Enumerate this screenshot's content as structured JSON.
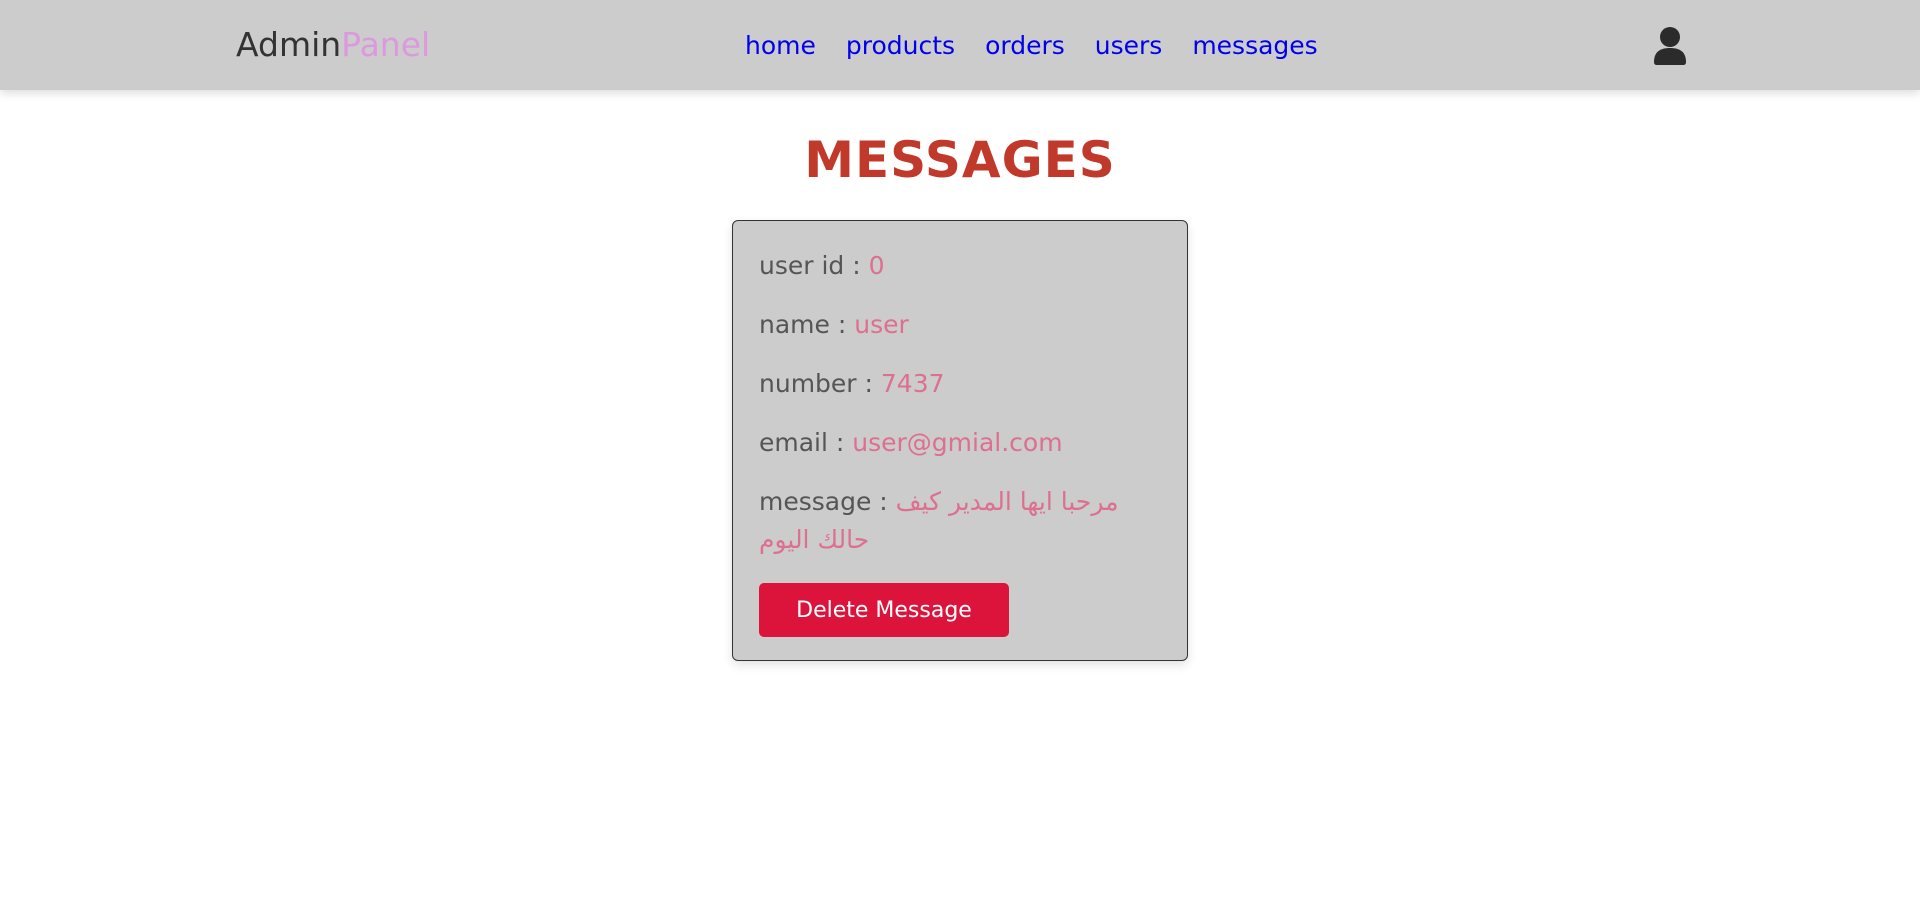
{
  "header": {
    "logo_main": "Admin",
    "logo_accent": "Panel",
    "nav": [
      "home",
      "products",
      "orders",
      "users",
      "messages"
    ],
    "user_icon": "user-icon"
  },
  "page": {
    "title": "MESSAGES"
  },
  "message_card": {
    "user_id_label": "user id : ",
    "user_id": "0",
    "name_label": "name : ",
    "name": "user",
    "number_label": "number : ",
    "number": "7437",
    "email_label": "email : ",
    "email": "user@gmial.com",
    "message_label": "message : ",
    "message": "مرحبا ايها المدير كيف حالك اليوم",
    "delete_label": "Delete Message"
  },
  "colors": {
    "header_bg": "#cccccc",
    "logo_accent": "#dd99dd",
    "nav_link": "#0000ee",
    "title": "#c0392b",
    "value_text": "#dd6f8f",
    "delete_button": "#dc143c"
  }
}
